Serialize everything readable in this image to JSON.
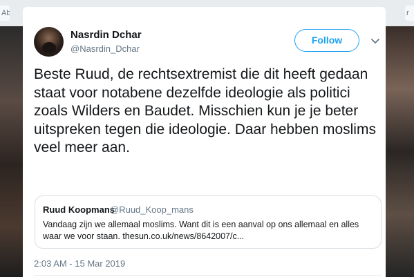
{
  "background": {
    "left_tab_text": "Ab",
    "right_tab_text": "r"
  },
  "tweet": {
    "author": {
      "display_name": "Nasrdin Dchar",
      "handle": "@Nasrdin_Dchar",
      "avatar_icon": "avatar-photo"
    },
    "follow_label": "Follow",
    "more_icon": "chevron-down-icon",
    "text": "Beste Ruud, de rechtsextremist die dit heeft gedaan staat voor notabene dezelfde ideologie als politici zoals Wilders en Baudet. Misschien kun je je beter uitspreken tegen die ideologie. Daar hebben moslims veel meer aan.",
    "quoted": {
      "display_name": "Ruud Koopmans",
      "handle": "@Ruud_Koop_mans",
      "text": "Vandaag zijn we allemaal moslims. Want dit is een aanval op ons allemaal en alles waar we voor staan.  thesun.co.uk/news/8642007/c..."
    },
    "timestamp": "2:03 AM - 15 Mar 2019"
  },
  "colors": {
    "accent": "#1da1f2",
    "text_primary": "#14171a",
    "text_secondary": "#657786",
    "border": "#d8dee3"
  }
}
